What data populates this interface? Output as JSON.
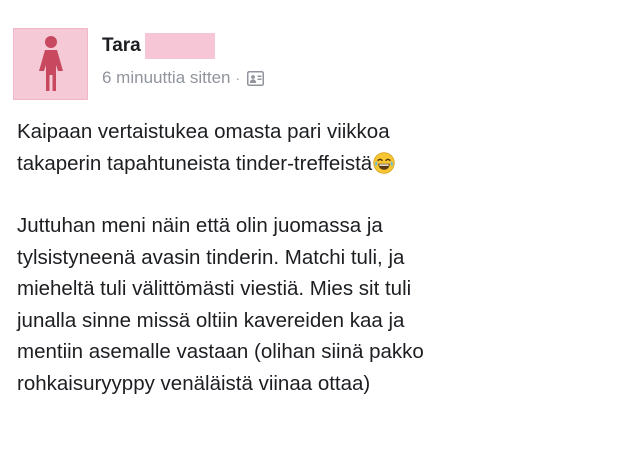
{
  "post": {
    "author_name": "Tara",
    "timestamp": "6 minuuttia sitten",
    "separator": "·",
    "audience_icon": "friends-audience-icon",
    "avatar_icon": "female-silhouette-icon",
    "paragraph1": {
      "line1": "Kaipaan vertaistukea omasta pari viikkoa",
      "line2": "takaperin tapahtuneista tinder-treffeistä"
    },
    "paragraph2": {
      "line1": "Juttuhan meni näin että olin juomassa ja",
      "line2": "tylsistyneenä avasin tinderin. Matchi tuli, ja",
      "line3": "mieheltä tuli välittömästi viestiä. Mies sit tuli",
      "line4": "junalla sinne missä oltiin kavereiden kaa ja",
      "line5": "mentiin asemalle vastaan (olihan siinä pakko",
      "line6": "rohkaisuryyppy venäläistä viinaa ottaa)"
    },
    "emoji": "laughing-tears-emoji"
  },
  "colors": {
    "avatar_bg": "#f6c9d6",
    "avatar_figure": "#c8485f",
    "redaction": "#f7c6d6",
    "text": "#1c1e21",
    "meta_text": "#90949c"
  }
}
